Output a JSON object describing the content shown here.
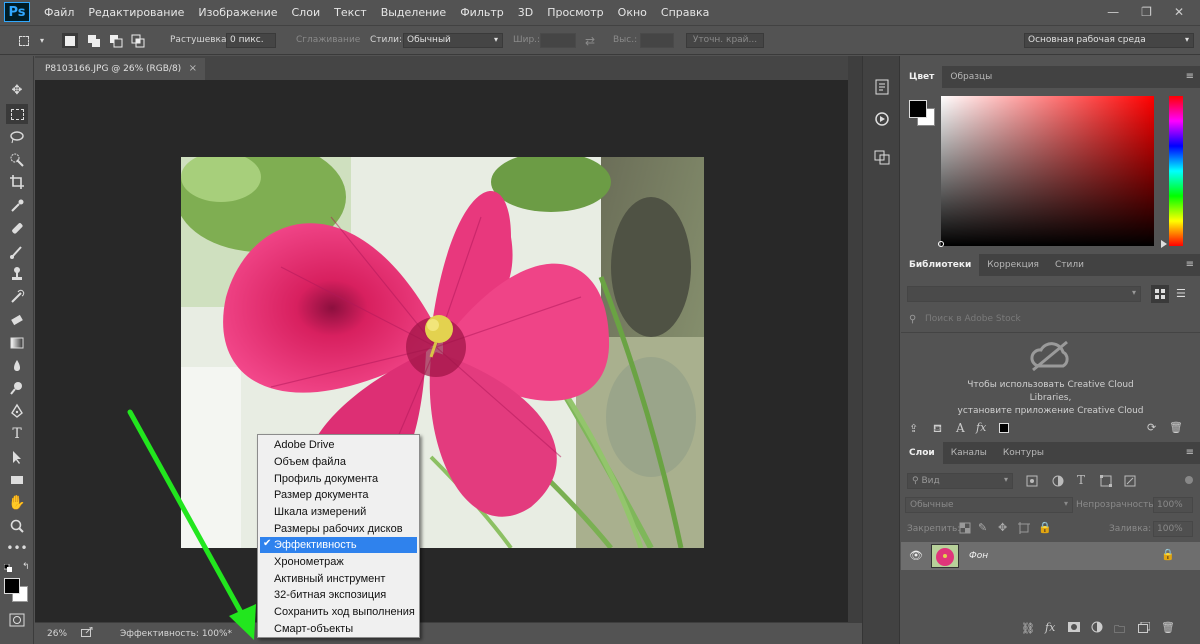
{
  "app": {
    "logo": "Ps"
  },
  "menu": [
    "Файл",
    "Редактирование",
    "Изображение",
    "Слои",
    "Текст",
    "Выделение",
    "Фильтр",
    "3D",
    "Просмотр",
    "Окно",
    "Справка"
  ],
  "window_controls": {
    "minimize": "—",
    "restore": "❐",
    "close": "✕"
  },
  "options": {
    "feather_label": "Растушевка:",
    "feather_value": "0 пикс.",
    "antialias_label": "Сглаживание",
    "style_label": "Стили:",
    "style_value": "Обычный",
    "width_label": "Шир.:",
    "height_label": "Выс.:",
    "refine_edge": "Уточн. край...",
    "workspace": "Основная рабочая среда"
  },
  "document": {
    "tab_title": "P8103166.JPG @ 26% (RGB/8)",
    "tab_close": "×"
  },
  "status": {
    "zoom": "26%",
    "info": "Эффективность: 100%*"
  },
  "popup": {
    "items": [
      "Adobe Drive",
      "Объем файла",
      "Профиль документа",
      "Размер документа",
      "Шкала измерений",
      "Размеры рабочих дисков",
      "Эффективность",
      "Хронометраж",
      "Активный инструмент",
      "32-битная экспозиция",
      "Сохранить ход выполнения",
      "Смарт-объекты"
    ],
    "selected_index": 6,
    "check": "✔"
  },
  "color_panel": {
    "tabs": [
      "Цвет",
      "Образцы"
    ],
    "hue_color": "#ff0000",
    "foreground": "#000000",
    "background": "#ffffff"
  },
  "libraries_panel": {
    "tabs": [
      "Библиотеки",
      "Коррекция",
      "Стили"
    ],
    "search_placeholder": "Поиск в Adobe Stock",
    "message_1": "Чтобы использовать Creative Cloud",
    "message_2": "Libraries,",
    "message_3": "установите приложение Creative Cloud"
  },
  "layers_panel": {
    "tabs": [
      "Слои",
      "Каналы",
      "Контуры"
    ],
    "filter_label": "Вид",
    "blend_mode": "Обычные",
    "opacity_label": "Непрозрачность:",
    "opacity_value": "100%",
    "lock_label": "Закрепить:",
    "fill_label": "Заливка:",
    "fill_value": "100%",
    "layers": [
      {
        "name": "Фон",
        "visible": true,
        "locked": true
      }
    ]
  },
  "annotation_color": "#22e61e"
}
